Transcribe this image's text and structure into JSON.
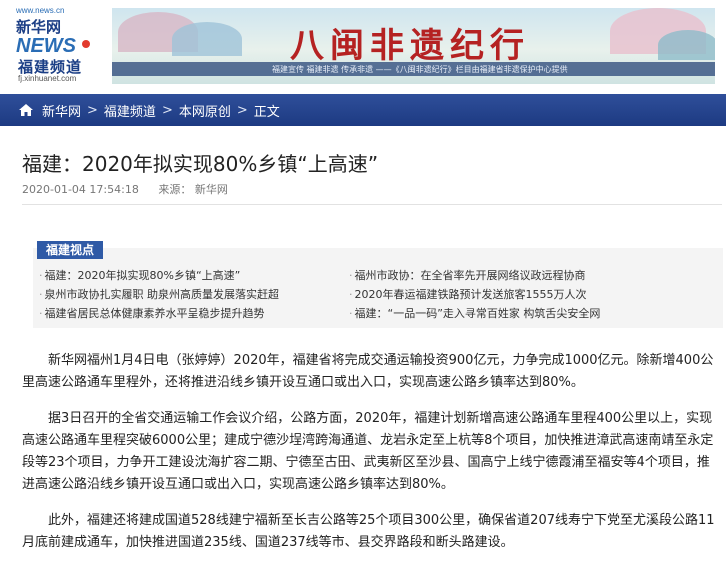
{
  "header": {
    "logo_url": "www.news.cn",
    "logo_brand": "新华网 NEWS",
    "logo_channel": "福建频道",
    "logo_sub_url": "fj.xinhuanet.com",
    "banner_title": "八闽非遗纪行",
    "banner_strip": "福建宣传  福建非遗  传承非遗 ——《八闽非遗纪行》栏目由福建省非遗保护中心提供"
  },
  "nav": {
    "crumbs": [
      "新华网",
      "本网原创",
      "正文"
    ],
    "channel": "福建频道",
    "separator": ">"
  },
  "article": {
    "title": "福建：2020年拟实现80%乡镇“上高速”",
    "datetime": "2020-01-04 17:54:18",
    "source_label": "来源：",
    "source": "新华网"
  },
  "related": {
    "tag": "福建视点",
    "left": [
      "福建：2020年拟实现80%乡镇“上高速”",
      "泉州市政协扎实履职 助泉州高质量发展落实赶超",
      "福建省居民总体健康素养水平呈稳步提升趋势"
    ],
    "right": [
      "福州市政协：在全省率先开展网络议政远程协商",
      "2020年春运福建铁路预计发送旅客1555万人次",
      "福建：“一品一码”走入寻常百姓家 构筑舌尖安全网"
    ]
  },
  "body": {
    "paragraphs": [
      "新华网福州1月4日电（张婷婷）2020年，福建省将完成交通运输投资900亿元，力争完成1000亿元。除新增400公里高速公路通车里程外，还将推进沿线乡镇开设互通口或出入口，实现高速公路乡镇率达到80%。",
      "据3日召开的全省交通运输工作会议介绍，公路方面，2020年，福建计划新增高速公路通车里程400公里以上，实现高速公路通车里程突破6000公里；建成宁德沙埕湾跨海通道、龙岩永定至上杭等8个项目，加快推进漳武高速南靖至永定段等23个项目，力争开工建设沈海扩容二期、宁德至古田、武夷新区至沙县、国高宁上线宁德霞浦至福安等4个项目，推进高速公路沿线乡镇开设互通口或出入口，实现高速公路乡镇率达到80%。",
      "此外，福建还将建成国道528线建宁福新至长吉公路等25个项目300公里，确保省道207线寿宁下党至尤溪段公路11月底前建成通车，加快推进国道235线、国道237线等市、县交界路段和断头路建设。"
    ]
  },
  "colors": {
    "nav_bg": "#1d3a82",
    "tag_bg": "#2f5aa6",
    "banner_title": "#b52222"
  }
}
